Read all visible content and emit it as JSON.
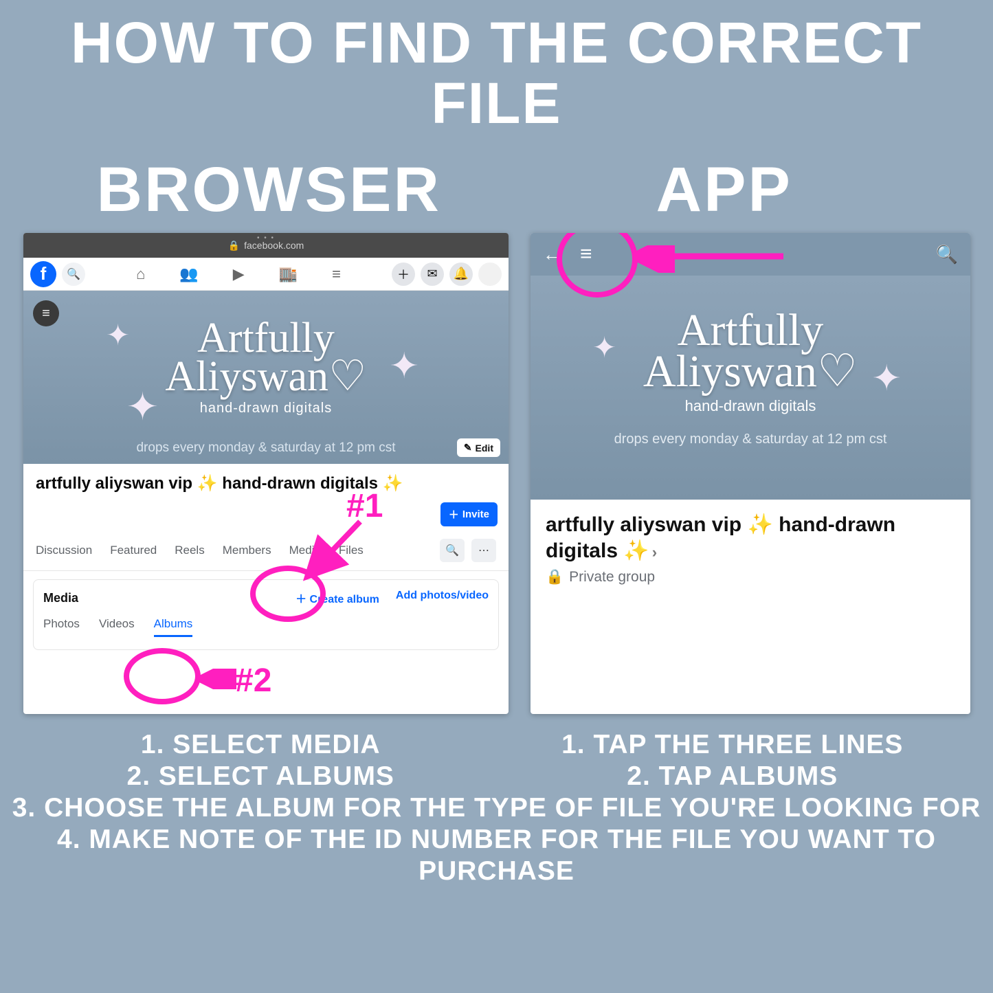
{
  "title": "HOW TO FIND THE CORRECT FILE",
  "col_browser": "BROWSER",
  "col_app": "APP",
  "browser": {
    "url": "facebook.com",
    "lock": "🔒",
    "cover": {
      "brand_line1": "Artfully",
      "brand_line2": "Aliyswan♡",
      "tagline": "hand-drawn digitals",
      "drops": "drops every monday & saturday at 12 pm cst",
      "edit_label": "Edit"
    },
    "group_title": "artfully aliyswan vip ✨ hand-drawn digitals ✨",
    "invite": "Invite",
    "tabs": [
      "Discussion",
      "Featured",
      "Reels",
      "Members",
      "Media",
      "Files"
    ],
    "media": {
      "title": "Media",
      "create_album": "Create album",
      "add_photos": "Add photos/video",
      "subtabs": [
        "Photos",
        "Videos",
        "Albums"
      ],
      "selected": "Albums"
    },
    "anno1": "#1",
    "anno2": "#2"
  },
  "app": {
    "cover": {
      "brand_line1": "Artfully",
      "brand_line2": "Aliyswan♡",
      "tagline": "hand-drawn digitals",
      "drops": "drops every monday & saturday at 12 pm cst"
    },
    "title": "artfully aliyswan vip ✨ hand-drawn digitals ✨",
    "privacy": "Private group"
  },
  "instructions": {
    "browser": [
      "1. SELECT MEDIA",
      "2. SELECT ALBUMS"
    ],
    "app": [
      "1. TAP THE THREE LINES",
      "2. TAP ALBUMS"
    ],
    "shared": [
      "3. CHOOSE THE ALBUM FOR THE TYPE OF FILE YOU'RE LOOKING FOR",
      "4. MAKE NOTE OF THE ID NUMBER FOR THE FILE YOU WANT TO PURCHASE"
    ]
  }
}
